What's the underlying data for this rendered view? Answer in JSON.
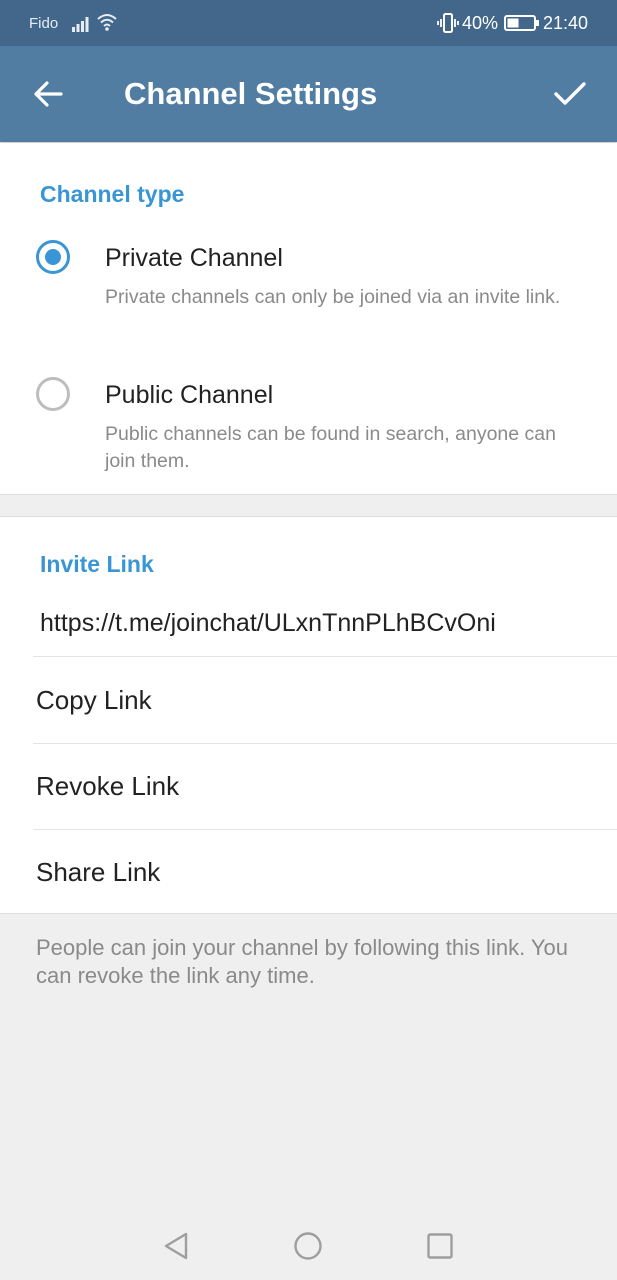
{
  "status_bar": {
    "carrier": "Fido",
    "battery_percent": "40%",
    "time": "21:40",
    "icons": [
      "signal-icon",
      "wifi-icon",
      "vibrate-icon",
      "battery-icon"
    ]
  },
  "app_bar": {
    "title": "Channel Settings",
    "back_icon": "arrow-left-icon",
    "done_icon": "checkmark-icon",
    "background_color": "#517da2"
  },
  "channel_type": {
    "header": "Channel type",
    "options": [
      {
        "title": "Private Channel",
        "description": "Private channels can only be joined via an invite link.",
        "selected": true
      },
      {
        "title": "Public Channel",
        "description": "Public channels can be found in search, anyone can join them.",
        "selected": false
      }
    ]
  },
  "invite_link": {
    "header": "Invite Link",
    "link": "https://t.me/joinchat/ULxnTnnPLhBCvOni",
    "actions": [
      "Copy Link",
      "Revoke Link",
      "Share Link"
    ]
  },
  "footer_note": "People can join your channel by following this link. You can revoke the link any time.",
  "nav_bar": {
    "buttons": [
      "back-triangle-icon",
      "home-circle-icon",
      "recents-square-icon"
    ]
  },
  "colors": {
    "accent": "#3a95d5",
    "status_bar": "#43678a",
    "background": "#efefef"
  }
}
